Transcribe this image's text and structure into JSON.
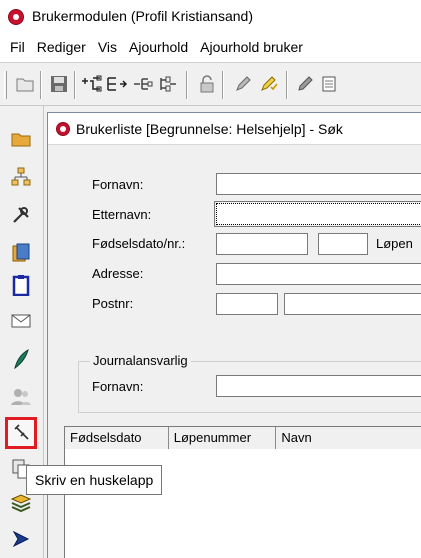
{
  "window": {
    "title": "Brukermodulen (Profil Kristiansand)"
  },
  "menu": {
    "items": [
      "Fil",
      "Rediger",
      "Vis",
      "Ajourhold",
      "Ajourhold bruker"
    ]
  },
  "toolbar": {
    "icons": [
      "open-folder-icon",
      "save-icon",
      "tree-expand-icon",
      "tree-forward-icon",
      "tree-collapse-icon",
      "tree-sibling-icon",
      "unlock-icon",
      "pen-icon",
      "pen-check-icon",
      "pencil-icon",
      "document-icon"
    ]
  },
  "left_toolbar": {
    "icons": [
      "folder-icon",
      "org-chart-icon",
      "tools-icon",
      "document-stack-icon",
      "clipboard-icon",
      "envelope-icon",
      "feather-icon",
      "users-icon",
      "pin-icon",
      "copy-icon",
      "books-icon",
      "arrow-icon"
    ],
    "highlighted": "pin-icon"
  },
  "tooltip": {
    "text": "Skriv en huskelapp"
  },
  "child_window": {
    "title": "Brukerliste  [Begrunnelse: Helsehjelp] - Søk"
  },
  "form": {
    "fornavn_label": "Fornavn:",
    "etternavn_label": "Etternavn:",
    "fodselsdato_label": "Fødselsdato/nr.:",
    "lopenummer_label": "Løpen",
    "adresse_label": "Adresse:",
    "postnr_label": "Postnr:",
    "fornavn_value": "",
    "etternavn_value": "",
    "adresse_value": "",
    "postnr_value": ""
  },
  "journal_group": {
    "legend": "Journalansvarlig",
    "fornavn_label": "Fornavn:",
    "fornavn_value": ""
  },
  "table": {
    "columns": [
      "Fødselsdato",
      "Løpenummer",
      "Navn"
    ],
    "rows": []
  },
  "colors": {
    "highlight": "#e11b22",
    "app_icon": "#c8102e"
  }
}
